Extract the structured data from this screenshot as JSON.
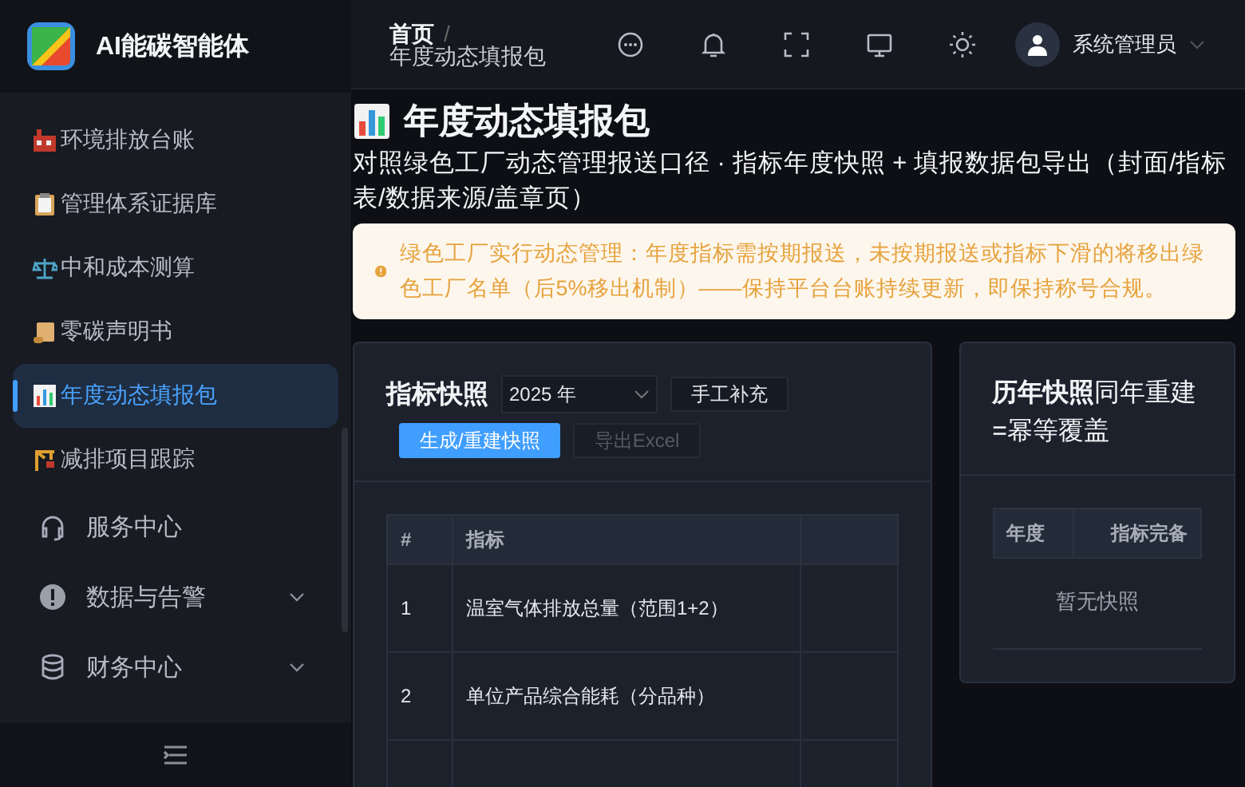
{
  "sidebar": {
    "brand": "AI能碳智能体",
    "items": [
      {
        "kind": "sub",
        "label": "环境排放台账",
        "selected": false
      },
      {
        "kind": "sub",
        "label": "管理体系证据库",
        "selected": false
      },
      {
        "kind": "sub",
        "label": "中和成本测算",
        "selected": false
      },
      {
        "kind": "sub",
        "label": "零碳声明书",
        "selected": false
      },
      {
        "kind": "sub",
        "label": "年度动态填报包",
        "selected": true
      },
      {
        "kind": "sub",
        "label": "减排项目跟踪",
        "selected": false
      },
      {
        "kind": "menu",
        "label": "服务中心",
        "selected": false
      },
      {
        "kind": "group",
        "label": "数据与告警",
        "selected": false,
        "expanded": false
      },
      {
        "kind": "group",
        "label": "财务中心",
        "selected": false,
        "expanded": false
      }
    ]
  },
  "header": {
    "breadcrumb": [
      "首页",
      "年度动态填报包"
    ],
    "separator": "/",
    "user": "系统管理员"
  },
  "page": {
    "title": "年度动态填报包",
    "subtitle": "对照绿色工厂动态管理报送口径 · 指标年度快照 + 填报数据包导出（封面/指标表/数据来源/盖章页）",
    "alert": "绿色工厂实行动态管理：年度指标需按期报送，未按期报送或指标下滑的将移出绿色工厂名单（后5%移出机制）——保持平台台账持续更新，即保持称号合规。"
  },
  "snapshot": {
    "title": "指标快照",
    "year": "2025 年",
    "buttons": [
      {
        "label": "手工补充",
        "kind": "plain",
        "disabled": false
      },
      {
        "label": "生成/重建快照",
        "kind": "primary",
        "disabled": false
      },
      {
        "label": "导出Excel",
        "kind": "plain",
        "disabled": true
      }
    ],
    "table": {
      "columns": [
        "#",
        "指标"
      ],
      "rows": [
        [
          "1",
          "温室气体排放总量（范围1+2）"
        ],
        [
          "2",
          "单位产品综合能耗（分品种）"
        ],
        [
          "",
          ""
        ]
      ]
    }
  },
  "history": {
    "title": "**历年快照**同年重建=幂等覆盖",
    "table": {
      "columns": [
        "年度",
        "指标完备"
      ]
    },
    "empty": "暂无快照"
  }
}
